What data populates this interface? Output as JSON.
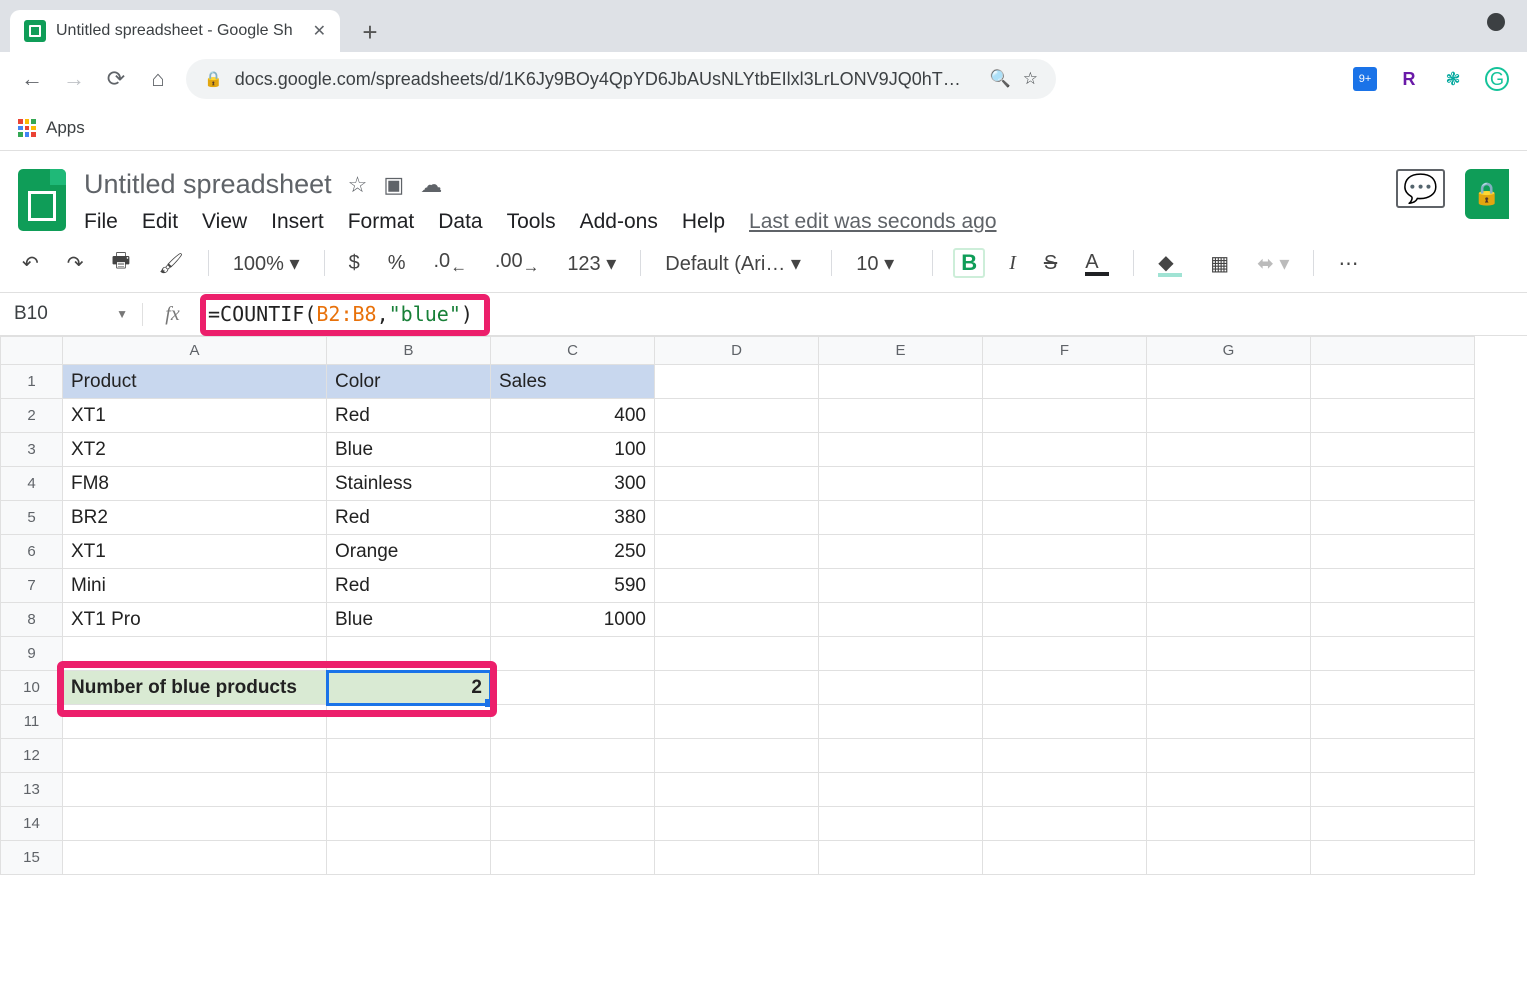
{
  "browser": {
    "tab_title": "Untitled spreadsheet - Google Sh",
    "url_display": "docs.google.com/spreadsheets/d/1K6Jy9BOy4QpYD6JbAUsNLYtbEIlxl3LrLONV9JQ0hT…",
    "bookmarks_apps_label": "Apps"
  },
  "doc": {
    "title": "Untitled spreadsheet",
    "menus": [
      "File",
      "Edit",
      "View",
      "Insert",
      "Format",
      "Data",
      "Tools",
      "Add-ons",
      "Help"
    ],
    "last_edit": "Last edit was seconds ago"
  },
  "toolbar": {
    "zoom": "100%",
    "currency": "$",
    "percent": "%",
    "dec_dec": ".0",
    "inc_dec": ".00",
    "num_menu": "123",
    "font": "Default (Ari…",
    "font_size": "10"
  },
  "namebox": {
    "ref": "B10"
  },
  "formula": {
    "prefix": "=COUNTIF(",
    "range": "B2:B8",
    "comma": ",",
    "string": "\"blue\"",
    "suffix": ")"
  },
  "columns": [
    "A",
    "B",
    "C",
    "D",
    "E",
    "F",
    "G"
  ],
  "header_row": {
    "A": "Product",
    "B": "Color",
    "C": "Sales"
  },
  "rows": [
    {
      "A": "XT1",
      "B": "Red",
      "C": "400"
    },
    {
      "A": "XT2",
      "B": "Blue",
      "C": "100"
    },
    {
      "A": "FM8",
      "B": "Stainless",
      "C": "300"
    },
    {
      "A": "BR2",
      "B": "Red",
      "C": "380"
    },
    {
      "A": "XT1",
      "B": "Orange",
      "C": "250"
    },
    {
      "A": "Mini",
      "B": "Red",
      "C": "590"
    },
    {
      "A": "XT1 Pro",
      "B": "Blue",
      "C": "1000"
    }
  ],
  "summary": {
    "label": "Number of blue products",
    "value": "2"
  },
  "row_count": 15
}
